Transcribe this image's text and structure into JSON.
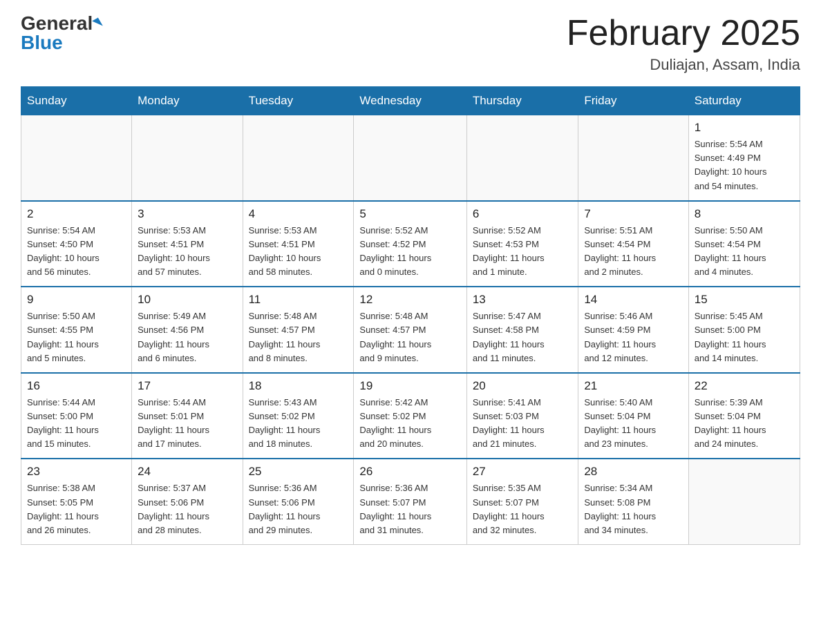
{
  "header": {
    "logo_general": "General",
    "logo_blue": "Blue",
    "month_title": "February 2025",
    "location": "Duliajan, Assam, India"
  },
  "weekdays": [
    "Sunday",
    "Monday",
    "Tuesday",
    "Wednesday",
    "Thursday",
    "Friday",
    "Saturday"
  ],
  "weeks": [
    [
      {
        "day": "",
        "info": ""
      },
      {
        "day": "",
        "info": ""
      },
      {
        "day": "",
        "info": ""
      },
      {
        "day": "",
        "info": ""
      },
      {
        "day": "",
        "info": ""
      },
      {
        "day": "",
        "info": ""
      },
      {
        "day": "1",
        "info": "Sunrise: 5:54 AM\nSunset: 4:49 PM\nDaylight: 10 hours\nand 54 minutes."
      }
    ],
    [
      {
        "day": "2",
        "info": "Sunrise: 5:54 AM\nSunset: 4:50 PM\nDaylight: 10 hours\nand 56 minutes."
      },
      {
        "day": "3",
        "info": "Sunrise: 5:53 AM\nSunset: 4:51 PM\nDaylight: 10 hours\nand 57 minutes."
      },
      {
        "day": "4",
        "info": "Sunrise: 5:53 AM\nSunset: 4:51 PM\nDaylight: 10 hours\nand 58 minutes."
      },
      {
        "day": "5",
        "info": "Sunrise: 5:52 AM\nSunset: 4:52 PM\nDaylight: 11 hours\nand 0 minutes."
      },
      {
        "day": "6",
        "info": "Sunrise: 5:52 AM\nSunset: 4:53 PM\nDaylight: 11 hours\nand 1 minute."
      },
      {
        "day": "7",
        "info": "Sunrise: 5:51 AM\nSunset: 4:54 PM\nDaylight: 11 hours\nand 2 minutes."
      },
      {
        "day": "8",
        "info": "Sunrise: 5:50 AM\nSunset: 4:54 PM\nDaylight: 11 hours\nand 4 minutes."
      }
    ],
    [
      {
        "day": "9",
        "info": "Sunrise: 5:50 AM\nSunset: 4:55 PM\nDaylight: 11 hours\nand 5 minutes."
      },
      {
        "day": "10",
        "info": "Sunrise: 5:49 AM\nSunset: 4:56 PM\nDaylight: 11 hours\nand 6 minutes."
      },
      {
        "day": "11",
        "info": "Sunrise: 5:48 AM\nSunset: 4:57 PM\nDaylight: 11 hours\nand 8 minutes."
      },
      {
        "day": "12",
        "info": "Sunrise: 5:48 AM\nSunset: 4:57 PM\nDaylight: 11 hours\nand 9 minutes."
      },
      {
        "day": "13",
        "info": "Sunrise: 5:47 AM\nSunset: 4:58 PM\nDaylight: 11 hours\nand 11 minutes."
      },
      {
        "day": "14",
        "info": "Sunrise: 5:46 AM\nSunset: 4:59 PM\nDaylight: 11 hours\nand 12 minutes."
      },
      {
        "day": "15",
        "info": "Sunrise: 5:45 AM\nSunset: 5:00 PM\nDaylight: 11 hours\nand 14 minutes."
      }
    ],
    [
      {
        "day": "16",
        "info": "Sunrise: 5:44 AM\nSunset: 5:00 PM\nDaylight: 11 hours\nand 15 minutes."
      },
      {
        "day": "17",
        "info": "Sunrise: 5:44 AM\nSunset: 5:01 PM\nDaylight: 11 hours\nand 17 minutes."
      },
      {
        "day": "18",
        "info": "Sunrise: 5:43 AM\nSunset: 5:02 PM\nDaylight: 11 hours\nand 18 minutes."
      },
      {
        "day": "19",
        "info": "Sunrise: 5:42 AM\nSunset: 5:02 PM\nDaylight: 11 hours\nand 20 minutes."
      },
      {
        "day": "20",
        "info": "Sunrise: 5:41 AM\nSunset: 5:03 PM\nDaylight: 11 hours\nand 21 minutes."
      },
      {
        "day": "21",
        "info": "Sunrise: 5:40 AM\nSunset: 5:04 PM\nDaylight: 11 hours\nand 23 minutes."
      },
      {
        "day": "22",
        "info": "Sunrise: 5:39 AM\nSunset: 5:04 PM\nDaylight: 11 hours\nand 24 minutes."
      }
    ],
    [
      {
        "day": "23",
        "info": "Sunrise: 5:38 AM\nSunset: 5:05 PM\nDaylight: 11 hours\nand 26 minutes."
      },
      {
        "day": "24",
        "info": "Sunrise: 5:37 AM\nSunset: 5:06 PM\nDaylight: 11 hours\nand 28 minutes."
      },
      {
        "day": "25",
        "info": "Sunrise: 5:36 AM\nSunset: 5:06 PM\nDaylight: 11 hours\nand 29 minutes."
      },
      {
        "day": "26",
        "info": "Sunrise: 5:36 AM\nSunset: 5:07 PM\nDaylight: 11 hours\nand 31 minutes."
      },
      {
        "day": "27",
        "info": "Sunrise: 5:35 AM\nSunset: 5:07 PM\nDaylight: 11 hours\nand 32 minutes."
      },
      {
        "day": "28",
        "info": "Sunrise: 5:34 AM\nSunset: 5:08 PM\nDaylight: 11 hours\nand 34 minutes."
      },
      {
        "day": "",
        "info": ""
      }
    ]
  ]
}
